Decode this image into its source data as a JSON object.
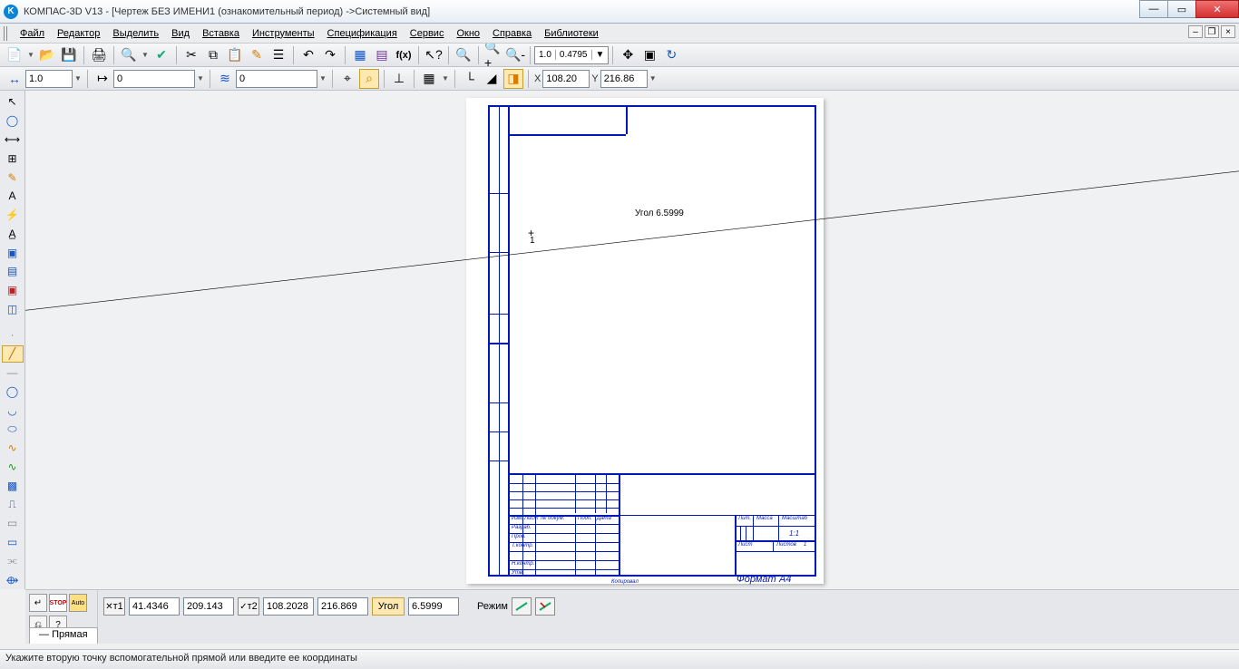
{
  "title": "КОМПАС-3D V13 - [Чертеж БЕЗ ИМЕНИ1 (ознакомительный период) ->Системный вид]",
  "menu": {
    "file": "Файл",
    "editor": "Редактор",
    "select": "Выделить",
    "view": "Вид",
    "insert": "Вставка",
    "tools": "Инструменты",
    "spec": "Спецификация",
    "service": "Сервис",
    "window": "Окно",
    "help": "Справка",
    "libs": "Библиотеки"
  },
  "toolbar2": {
    "step": "1.0",
    "snap": "0",
    "layer": "0"
  },
  "view": {
    "scale_a": "1.0",
    "scale_b": "0.4795",
    "x": "108.20",
    "y": "216.86"
  },
  "angle_hint": "Угол 6.5999",
  "cursor_label": "1",
  "title_block": {
    "scale": "1:1",
    "row_izm": "Изм.",
    "row_list": "Лист",
    "row_ndok": "№ докум.",
    "row_podp": "Подп.",
    "row_data": "Дата",
    "row_razrab": "Разраб.",
    "row_prov": "Пров.",
    "row_tkontr": "Т.контр.",
    "row_nkontr": "Н.контр.",
    "row_utv": "Утв.",
    "lbl_lit": "Лит.",
    "lbl_massa": "Масса",
    "lbl_masht": "Масштаб",
    "lbl_list": "Лист",
    "lbl_listov": "Листов",
    "lbl_listov_val": "1",
    "kopiroval": "Копировал",
    "format": "Формат",
    "format_val": "A4"
  },
  "prop": {
    "t1": "т1",
    "t1x": "41.4346",
    "t1y": "209.143",
    "t2": "т2",
    "t2x": "108.2028",
    "t2y": "216.869",
    "ang_lbl": "Угол",
    "ang_val": "6.5999",
    "mode": "Режим",
    "tab": "Прямая"
  },
  "status": "Укажите вторую точку вспомогательной прямой или введите ее координаты",
  "stop_lbl": "STOP",
  "auto_lbl": "Auto"
}
